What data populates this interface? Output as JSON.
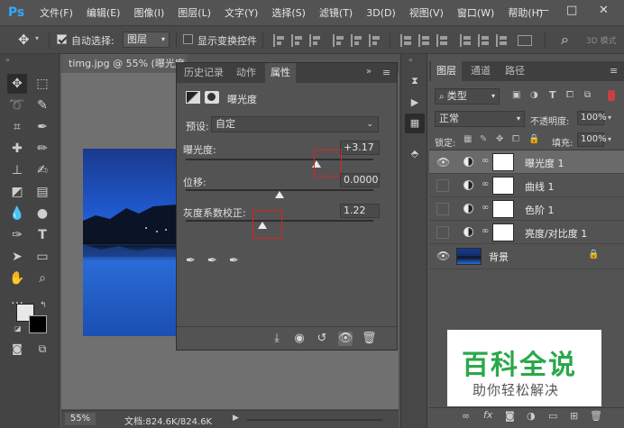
{
  "app": {
    "logo": "Ps"
  },
  "menu": [
    "文件(F)",
    "编辑(E)",
    "图像(I)",
    "图层(L)",
    "文字(Y)",
    "选择(S)",
    "滤镜(T)",
    "3D(D)",
    "视图(V)",
    "窗口(W)",
    "帮助(H)"
  ],
  "window_controls": {
    "minimize": "—",
    "maximize": "□",
    "close": "✕"
  },
  "options": {
    "auto_select_label": "自动选择:",
    "auto_select_checked": true,
    "auto_select_target": "图层",
    "show_transform_label": "显示变换控件",
    "show_transform_checked": false,
    "mode_3d": "3D 模式"
  },
  "document": {
    "tab_title": "timg.jpg @ 55% (曝光度 1, 蒙版/8)",
    "zoom": "55%",
    "doc_info": "文档:824.6K/824.6K"
  },
  "properties": {
    "tabs": [
      "历史记录",
      "动作",
      "属性"
    ],
    "active_tab": 2,
    "panel_title": "曝光度",
    "preset_label": "预设:",
    "preset_value": "自定",
    "exposure": {
      "label": "曝光度:",
      "value": "+3.17",
      "level_fraction": 0.695
    },
    "offset": {
      "label": "位移:",
      "value": "0.0000",
      "level_fraction": 0.5
    },
    "gamma": {
      "label": "灰度系数校正:",
      "value": "1.22",
      "level_fraction": 0.41
    }
  },
  "layers": {
    "tabs": [
      "图层",
      "通道",
      "路径"
    ],
    "filter_kind": "类型",
    "blend_mode": "正常",
    "opacity_label": "不透明度:",
    "opacity_value": "100%",
    "lock_label": "锁定:",
    "fill_label": "填充:",
    "fill_value": "100%",
    "items": [
      {
        "name": "曝光度 1",
        "visible": true,
        "selected": true
      },
      {
        "name": "曲线 1",
        "visible": false,
        "selected": false
      },
      {
        "name": "色阶 1",
        "visible": false,
        "selected": false
      },
      {
        "name": "亮度/对比度 1",
        "visible": false,
        "selected": false
      },
      {
        "name": "背景",
        "visible": true,
        "selected": false
      }
    ]
  },
  "watermark": {
    "title": "百科全说",
    "subtitle": "助你轻松解决"
  },
  "colors": {
    "accent": "#31a8ff",
    "highlight_box": "#e0201c",
    "watermark_green": "#2aa84a"
  }
}
